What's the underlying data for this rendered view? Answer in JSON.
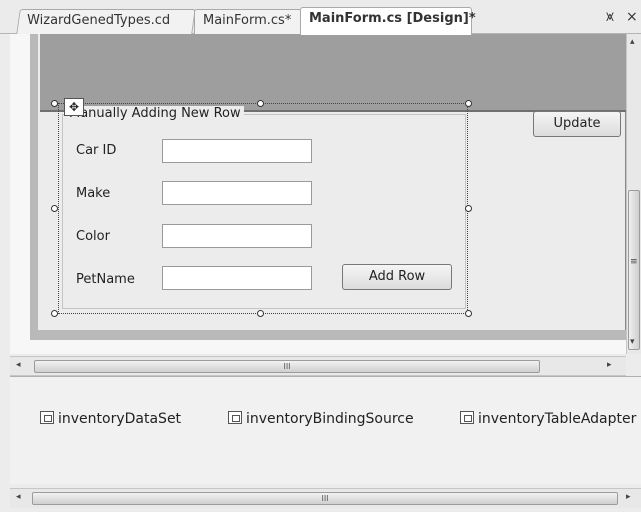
{
  "tabs": [
    {
      "label": "WizardGenedTypes.cd"
    },
    {
      "label": "MainForm.cs*"
    },
    {
      "label": "MainForm.cs [Design]*",
      "active": true
    }
  ],
  "tab_controls": {
    "dropdown_glyph": "⩙",
    "close_glyph": "×"
  },
  "form": {
    "update_button": "Update",
    "groupbox_title": "Manually Adding New Row",
    "fields": [
      {
        "label": "Car ID",
        "value": ""
      },
      {
        "label": "Make",
        "value": ""
      },
      {
        "label": "Color",
        "value": ""
      },
      {
        "label": "PetName",
        "value": ""
      }
    ],
    "add_row_button": "Add Row"
  },
  "scroll": {
    "thumb_grip": "III",
    "left_arrow": "◂",
    "right_arrow": "▸",
    "up_arrow": "▴",
    "down_arrow": "▾",
    "vgrip": "≡"
  },
  "tray": {
    "components": [
      {
        "label": "inventoryDataSet",
        "icon": "dataset-icon"
      },
      {
        "label": "inventoryBindingSource",
        "icon": "bindingsource-icon"
      },
      {
        "label": "inventoryTableAdapter",
        "icon": "tableadapter-icon"
      }
    ]
  }
}
